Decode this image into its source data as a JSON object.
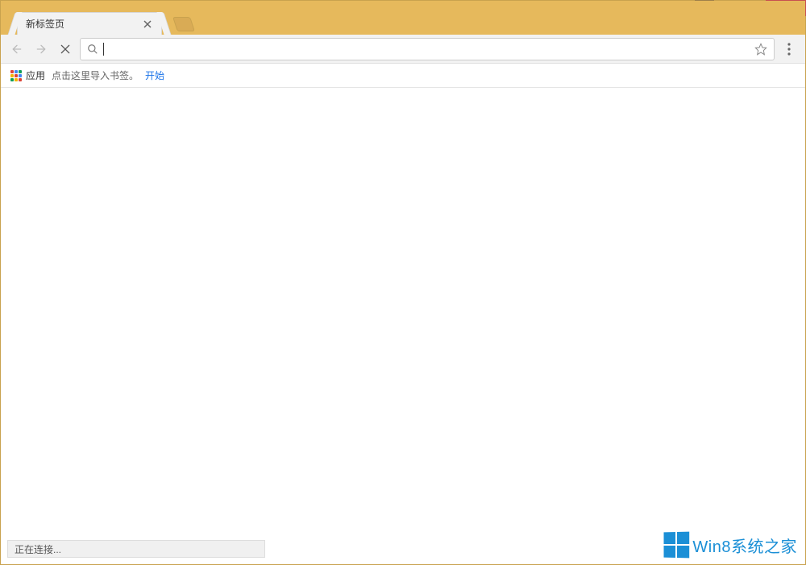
{
  "window_controls": {
    "user": "user",
    "minimize": "minimize",
    "maximize": "maximize",
    "close": "close"
  },
  "tab": {
    "title": "新标签页"
  },
  "toolbar": {
    "back": "back",
    "forward": "forward",
    "stop": "stop",
    "search_placeholder": "",
    "omnibox_value": ""
  },
  "bookmarks_bar": {
    "apps_label": "应用",
    "import_hint": "点击这里导入书签。",
    "start_link": "开始"
  },
  "statusbar": {
    "text": "正在连接..."
  },
  "watermark": {
    "text": "Win8系统之家"
  }
}
